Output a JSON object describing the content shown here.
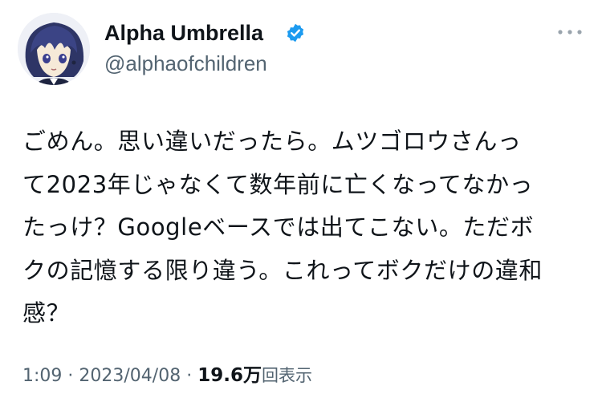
{
  "author": {
    "display_name": "Alpha Umbrella",
    "handle": "@alphaofchildren",
    "verified_icon": "verified-badge-icon",
    "avatar_icon": "anime-character-avatar"
  },
  "tweet": {
    "lines": [
      "ごめん。思い違いだったら。ムツゴロウさんっ",
      "て2023年じゃなくて数年前に亡くなってなかっ",
      "たっけ？Googleベースでは出てこない。ただボ",
      "クの記憶する限り違う。これってボクだけの違和",
      "感？"
    ]
  },
  "meta": {
    "time": "1:09",
    "separator1": "·",
    "date": "2023/04/08",
    "separator2": "·",
    "views_count": "19.6万",
    "views_suffix": "回表示"
  },
  "colors": {
    "text_primary": "#0f1419",
    "text_secondary": "#536471",
    "verified_blue": "#1d9bf0",
    "more_dots": "#9aa4ad"
  },
  "icons": {
    "more": "more-horizontal-icon"
  }
}
